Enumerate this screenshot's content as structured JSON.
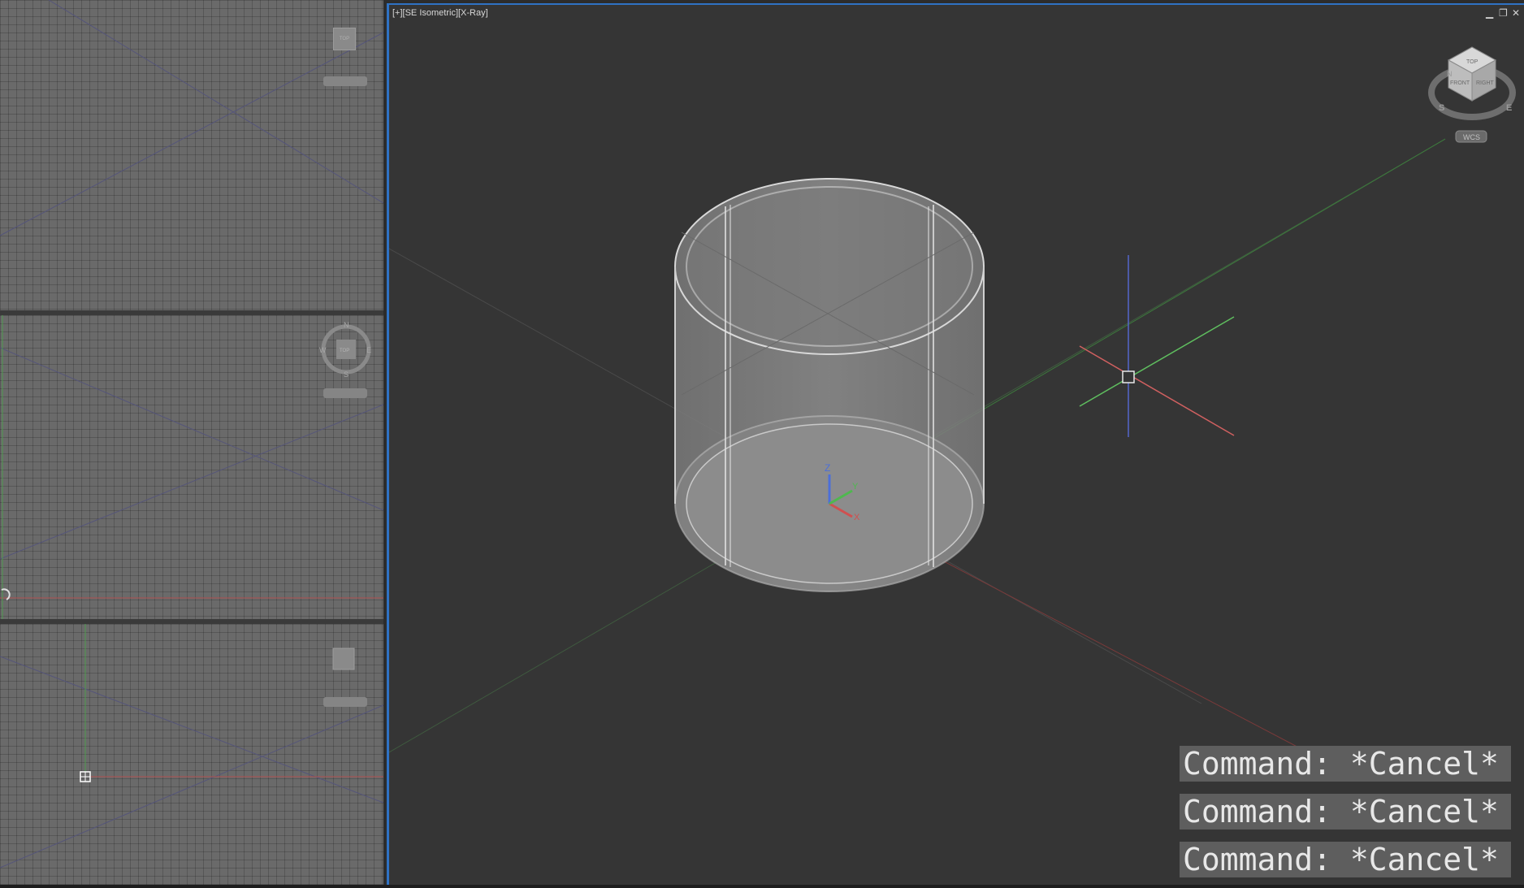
{
  "main_viewport": {
    "label": "[+][SE Isometric][X-Ray]",
    "controls": {
      "minimize": "▁",
      "restore": "❐",
      "close": "✕"
    }
  },
  "viewcube": {
    "top": "TOP",
    "front": "FRONT",
    "right": "RIGHT",
    "compass_s": "S",
    "compass_e": "E",
    "compass_n": "N",
    "wcs": "WCS"
  },
  "ucs_icon": {
    "x": "X",
    "y": "Y",
    "z": "Z"
  },
  "compass_mid": {
    "n": "N",
    "s": "S",
    "e": "E",
    "w": "W",
    "center": "TOP"
  },
  "mini_top": {
    "cube": "TOP"
  },
  "command_history": [
    "Command: *Cancel*",
    "Command: *Cancel*",
    "Command: *Cancel*"
  ],
  "colors": {
    "active_border": "#2f72c4",
    "x_axis": "#d05050",
    "y_axis": "#4fb84f",
    "z_axis": "#4c6fd8"
  }
}
